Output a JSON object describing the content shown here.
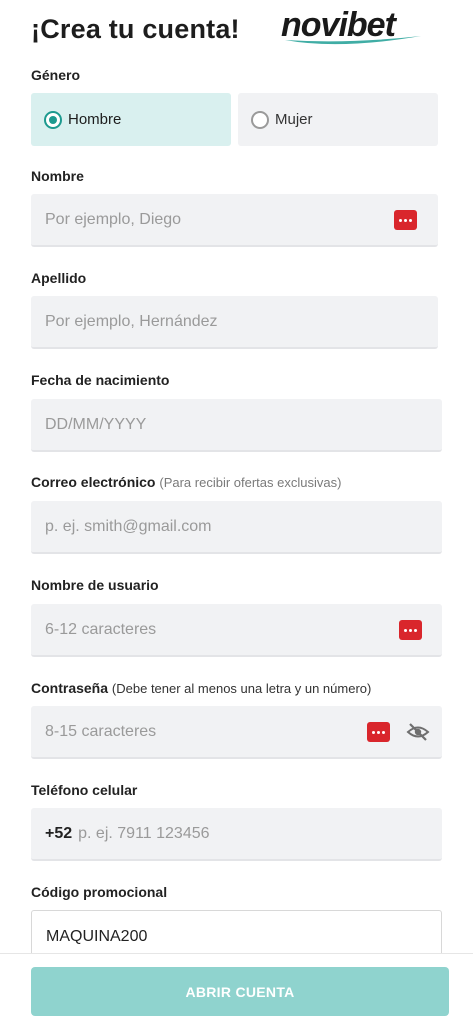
{
  "header": {
    "title": "¡Crea tu cuenta!",
    "logo_text": "novibet"
  },
  "form": {
    "gender": {
      "label": "Género",
      "options": [
        {
          "label": "Hombre",
          "selected": true
        },
        {
          "label": "Mujer",
          "selected": false
        }
      ]
    },
    "first_name": {
      "label": "Nombre",
      "placeholder": "Por ejemplo, Diego",
      "icon": "password-manager-icon"
    },
    "last_name": {
      "label": "Apellido",
      "placeholder": "Por ejemplo, Hernández"
    },
    "birth_date": {
      "label": "Fecha de nacimiento",
      "placeholder": "DD/MM/YYYY"
    },
    "email": {
      "label": "Correo electrónico",
      "hint": "(Para recibir ofertas exclusivas)",
      "placeholder": "p. ej. smith@gmail.com"
    },
    "username": {
      "label": "Nombre de usuario",
      "placeholder": "6-12 caracteres",
      "icon": "password-manager-icon"
    },
    "password": {
      "label": "Contraseña",
      "hint": "(Debe tener al menos una letra y un número)",
      "placeholder": "8-15 caracteres",
      "icons": [
        "password-manager-icon",
        "eye-slash-icon"
      ]
    },
    "phone": {
      "label": "Teléfono celular",
      "prefix": "+52",
      "placeholder": "p. ej. 7911 123456"
    },
    "promo": {
      "label": "Código promocional",
      "value": "MAQUINA200"
    }
  },
  "footer": {
    "submit_label": "ABRIR CUENTA"
  },
  "colors": {
    "accent": "#1d9a8f",
    "selected_bg": "#d9f0ef",
    "field_bg": "#f1f2f4",
    "cta_bg": "#8fd3ce",
    "password_manager_red": "#d9262c"
  }
}
